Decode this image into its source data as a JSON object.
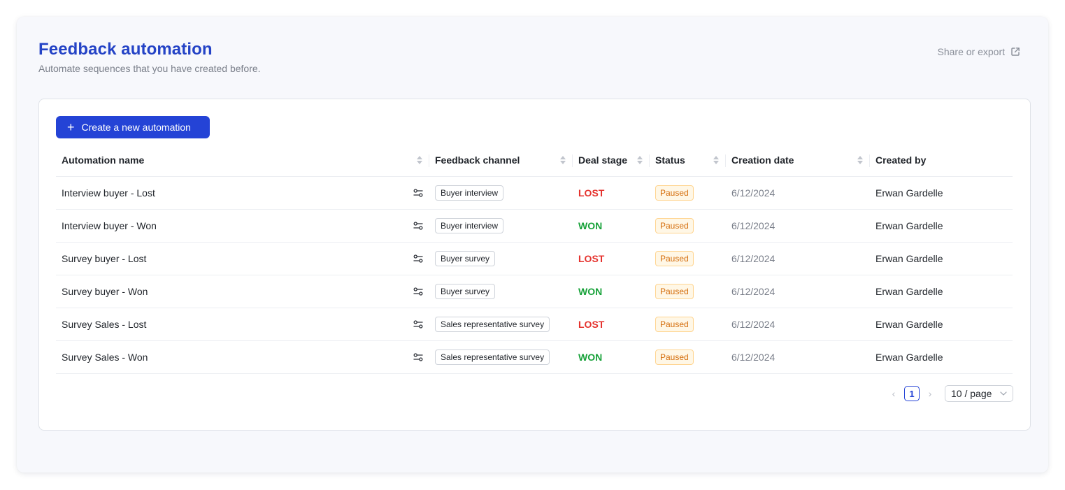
{
  "header": {
    "title": "Feedback automation",
    "subtitle": "Automate sequences that you have created before.",
    "share_label": "Share or export"
  },
  "toolbar": {
    "create_label": "Create a new automation"
  },
  "table": {
    "columns": [
      {
        "label": "Automation name",
        "sortable": true
      },
      {
        "label": "Feedback channel",
        "sortable": true
      },
      {
        "label": "Deal stage",
        "sortable": true
      },
      {
        "label": "Status",
        "sortable": true
      },
      {
        "label": "Creation date",
        "sortable": true
      },
      {
        "label": "Created by",
        "sortable": false
      }
    ],
    "rows": [
      {
        "name": "Interview buyer - Lost",
        "channel": "Buyer interview",
        "stage": "LOST",
        "status": "Paused",
        "date": "6/12/2024",
        "created_by": "Erwan Gardelle"
      },
      {
        "name": "Interview buyer - Won",
        "channel": "Buyer interview",
        "stage": "WON",
        "status": "Paused",
        "date": "6/12/2024",
        "created_by": "Erwan Gardelle"
      },
      {
        "name": "Survey buyer - Lost",
        "channel": "Buyer survey",
        "stage": "LOST",
        "status": "Paused",
        "date": "6/12/2024",
        "created_by": "Erwan Gardelle"
      },
      {
        "name": "Survey buyer - Won",
        "channel": "Buyer survey",
        "stage": "WON",
        "status": "Paused",
        "date": "6/12/2024",
        "created_by": "Erwan Gardelle"
      },
      {
        "name": "Survey Sales - Lost",
        "channel": "Sales representative survey",
        "stage": "LOST",
        "status": "Paused",
        "date": "6/12/2024",
        "created_by": "Erwan Gardelle"
      },
      {
        "name": "Survey Sales - Won",
        "channel": "Sales representative survey",
        "stage": "WON",
        "status": "Paused",
        "date": "6/12/2024",
        "created_by": "Erwan Gardelle"
      }
    ]
  },
  "pagination": {
    "prev_icon": "chevron-left-icon",
    "next_icon": "chevron-right-icon",
    "prev_glyph": "‹",
    "next_glyph": "›",
    "current_page": "1",
    "page_size": "10 / page"
  },
  "colors": {
    "accent": "#2443d6",
    "title": "#2443c6",
    "lost": "#e5322d",
    "won": "#18a23a",
    "paused_text": "#d46b08",
    "paused_bg": "#fff7e6"
  },
  "icons": {
    "share": "external-link-icon",
    "create": "plus-icon",
    "row_action": "settings-sliders-icon",
    "sort": "sort-icon",
    "select": "chevron-down-icon"
  }
}
